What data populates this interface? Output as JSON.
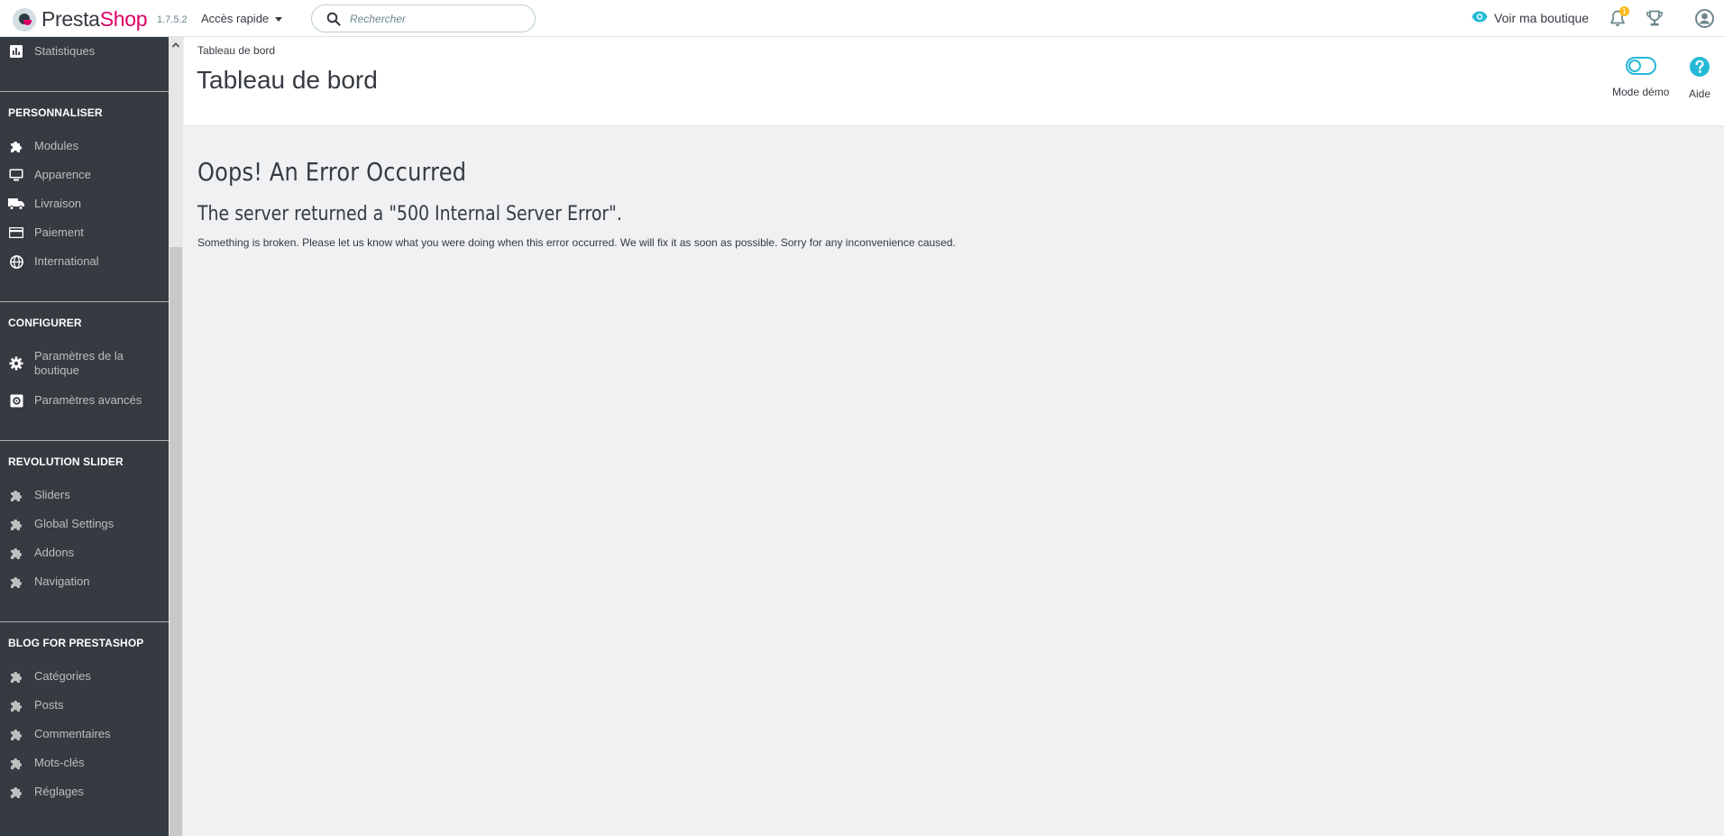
{
  "header": {
    "logo": {
      "part1": "Presta",
      "part2": "Shop"
    },
    "version": "1.7.5.2",
    "quick_access": "Accès rapide",
    "search_placeholder": "Rechercher",
    "view_shop": "Voir ma boutique",
    "notifications_count": "1",
    "colors": {
      "brand": "#df0067",
      "accent": "#25b9d7",
      "badge": "#fbbb22"
    }
  },
  "sidebar": {
    "top_item": {
      "label": "Statistiques",
      "icon": "bar-chart-icon"
    },
    "sections": [
      {
        "title": "PERSONNALISER",
        "items": [
          {
            "label": "Modules",
            "icon": "puzzle-icon"
          },
          {
            "label": "Apparence",
            "icon": "monitor-icon"
          },
          {
            "label": "Livraison",
            "icon": "truck-icon"
          },
          {
            "label": "Paiement",
            "icon": "credit-card-icon"
          },
          {
            "label": "International",
            "icon": "globe-icon"
          }
        ]
      },
      {
        "title": "CONFIGURER",
        "items": [
          {
            "label": "Paramètres de la boutique",
            "icon": "gear-icon"
          },
          {
            "label": "Paramètres avancés",
            "icon": "settings-box-icon"
          }
        ]
      },
      {
        "title": "REVOLUTION SLIDER",
        "items": [
          {
            "label": "Sliders",
            "icon": "puzzle-icon"
          },
          {
            "label": "Global Settings",
            "icon": "puzzle-icon"
          },
          {
            "label": "Addons",
            "icon": "puzzle-icon"
          },
          {
            "label": "Navigation",
            "icon": "puzzle-icon"
          }
        ]
      },
      {
        "title": "BLOG FOR PRESTASHOP",
        "items": [
          {
            "label": "Catégories",
            "icon": "puzzle-icon"
          },
          {
            "label": "Posts",
            "icon": "puzzle-icon"
          },
          {
            "label": "Commentaires",
            "icon": "puzzle-icon"
          },
          {
            "label": "Mots-clés",
            "icon": "puzzle-icon"
          },
          {
            "label": "Réglages",
            "icon": "puzzle-icon"
          }
        ]
      }
    ]
  },
  "page": {
    "breadcrumb": "Tableau de bord",
    "title": "Tableau de bord",
    "demo_mode": "Mode démo",
    "help": "Aide"
  },
  "error": {
    "title": "Oops! An Error Occurred",
    "subtitle": "The server returned a \"500 Internal Server Error\".",
    "message": "Something is broken. Please let us know what you were doing when this error occurred. We will fix it as soon as possible. Sorry for any inconvenience caused."
  }
}
